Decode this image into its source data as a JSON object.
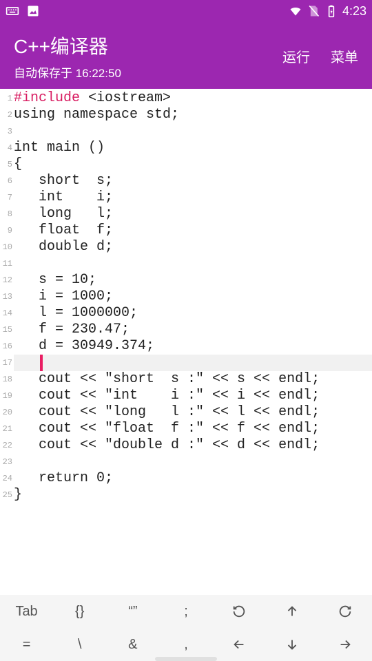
{
  "status": {
    "time": "4:23"
  },
  "app": {
    "title": "C++编译器",
    "subtitle": "自动保存于 16:22:50",
    "run": "运行",
    "menu": "菜单"
  },
  "code": {
    "lines": [
      {
        "n": 1,
        "preproc": "#include ",
        "rest": "<iostream>"
      },
      {
        "n": 2,
        "text": "using namespace std;"
      },
      {
        "n": 3,
        "text": ""
      },
      {
        "n": 4,
        "text": "int main ()"
      },
      {
        "n": 5,
        "text": "{"
      },
      {
        "n": 6,
        "text": "   short  s;"
      },
      {
        "n": 7,
        "text": "   int    i;"
      },
      {
        "n": 8,
        "text": "   long   l;"
      },
      {
        "n": 9,
        "text": "   float  f;"
      },
      {
        "n": 10,
        "text": "   double d;"
      },
      {
        "n": 11,
        "text": ""
      },
      {
        "n": 12,
        "text": "   s = 10;"
      },
      {
        "n": 13,
        "text": "   i = 1000;"
      },
      {
        "n": 14,
        "text": "   l = 1000000;"
      },
      {
        "n": 15,
        "text": "   f = 230.47;"
      },
      {
        "n": 16,
        "text": "   d = 30949.374;"
      },
      {
        "n": 17,
        "text": "   ",
        "cursor": true
      },
      {
        "n": 18,
        "text": "   cout << \"short  s :\" << s << endl;"
      },
      {
        "n": 19,
        "text": "   cout << \"int    i :\" << i << endl;"
      },
      {
        "n": 20,
        "text": "   cout << \"long   l :\" << l << endl;"
      },
      {
        "n": 21,
        "text": "   cout << \"float  f :\" << f << endl;"
      },
      {
        "n": 22,
        "text": "   cout << \"double d :\" << d << endl;"
      },
      {
        "n": 23,
        "text": ""
      },
      {
        "n": 24,
        "text": "   return 0;"
      },
      {
        "n": 25,
        "text": "}"
      }
    ]
  },
  "symbols": {
    "row1": [
      "Tab",
      "{}",
      "“”",
      ";"
    ],
    "row2": [
      "=",
      "\\",
      "&",
      ","
    ]
  }
}
